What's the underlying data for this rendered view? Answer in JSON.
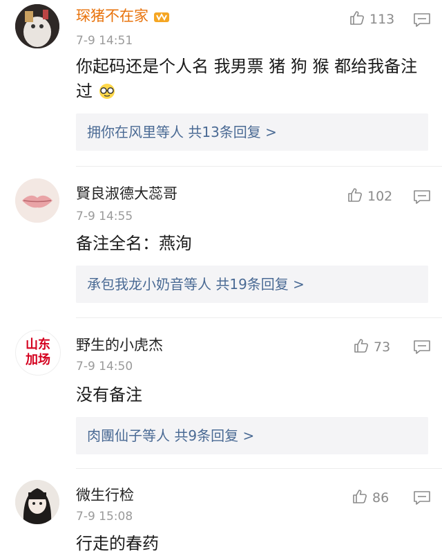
{
  "comments": [
    {
      "username": "琛猪不在家",
      "time": "7-9 14:51",
      "likes": "113",
      "text": "你起码还是个人名 我男票 猪 狗 猴 都给我备注过",
      "reply": "拥你在风里等人  共13条回复 >",
      "name_color": "#e8730c",
      "avatar_icon": "cat-photo-avatar",
      "emoji": "nerd-glasses-emoji"
    },
    {
      "username": "賢良淑德大蕊哥",
      "time": "7-9 14:55",
      "likes": "102",
      "text": "备注全名：燕洵",
      "reply": "承包我龙小奶音等人  共19条回复 >",
      "name_color": "#222222",
      "avatar_icon": "lips-avatar"
    },
    {
      "username": "野生的小虎杰",
      "time": "7-9 14:50",
      "likes": "73",
      "text": "没有备注",
      "reply": "肉團仙子等人  共9条回复 >",
      "name_color": "#222222",
      "avatar_text": "山东\n加场"
    },
    {
      "username": "微生行检",
      "time": "7-9 15:08",
      "likes": "86",
      "text": "行走的春药",
      "name_color": "#222222",
      "avatar_icon": "anime-girl-avatar"
    }
  ]
}
